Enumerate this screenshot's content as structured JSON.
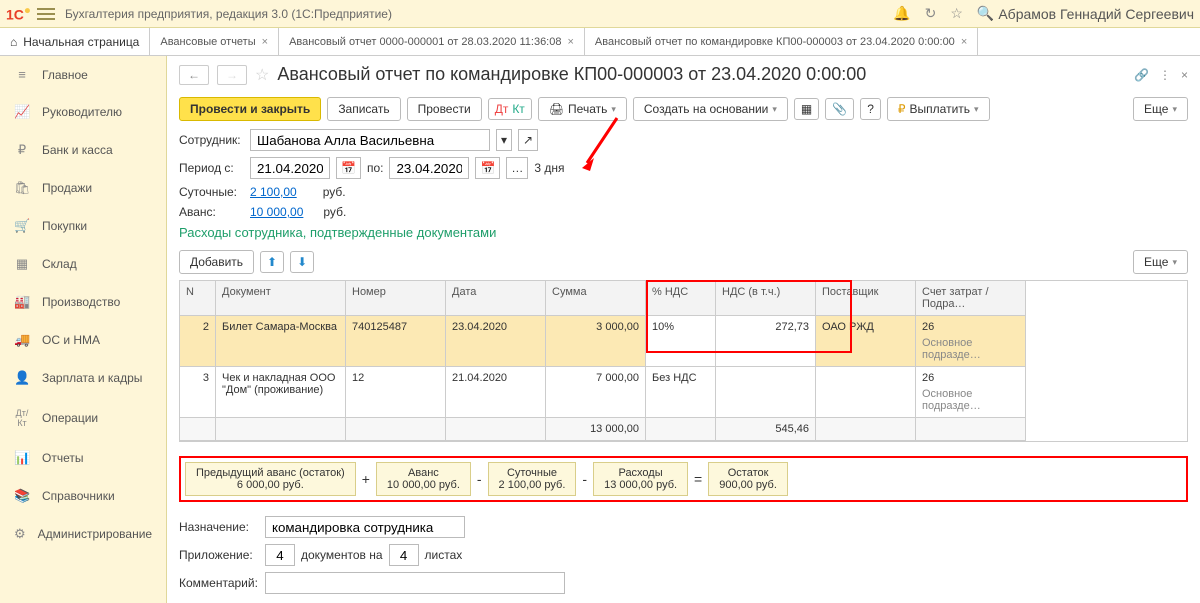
{
  "app": {
    "title": "Бухгалтерия предприятия, редакция 3.0  (1С:Предприятие)",
    "user": "Абрамов Геннадий Сергеевич"
  },
  "tabs": {
    "home": "Начальная страница",
    "t1": "Авансовые отчеты",
    "t2": "Авансовый отчет 0000-000001 от 28.03.2020 11:36:08",
    "t3": "Авансовый отчет по командировке КП00-000003 от 23.04.2020 0:00:00"
  },
  "sidebar": {
    "items": [
      {
        "icon": "≡",
        "label": "Главное"
      },
      {
        "icon": "📈",
        "label": "Руководителю"
      },
      {
        "icon": "₽",
        "label": "Банк и касса"
      },
      {
        "icon": "🛍",
        "label": "Продажи"
      },
      {
        "icon": "🛒",
        "label": "Покупки"
      },
      {
        "icon": "▦",
        "label": "Склад"
      },
      {
        "icon": "🏭",
        "label": "Производство"
      },
      {
        "icon": "🚚",
        "label": "ОС и НМА"
      },
      {
        "icon": "👤",
        "label": "Зарплата и кадры"
      },
      {
        "icon": "Дт/Кт",
        "label": "Операции"
      },
      {
        "icon": "📊",
        "label": "Отчеты"
      },
      {
        "icon": "📚",
        "label": "Справочники"
      },
      {
        "icon": "⚙",
        "label": "Администрирование"
      }
    ]
  },
  "page": {
    "title": "Авансовый отчет по командировке КП00-000003 от 23.04.2020 0:00:00"
  },
  "toolbar": {
    "process_close": "Провести и закрыть",
    "save": "Записать",
    "process": "Провести",
    "print": "Печать",
    "create_base": "Создать на основании",
    "pay": "Выплатить",
    "more": "Еще"
  },
  "form": {
    "employee_lbl": "Сотрудник:",
    "employee": "Шабанова Алла Васильевна",
    "period_lbl": "Период с:",
    "date_from": "21.04.2020",
    "to_lbl": "по:",
    "date_to": "23.04.2020",
    "days": "3 дня",
    "daily_lbl": "Суточные:",
    "daily": "2 100,00",
    "rub": "руб.",
    "advance_lbl": "Аванс:",
    "advance": "10 000,00",
    "section": "Расходы сотрудника, подтвержденные документами",
    "add": "Добавить"
  },
  "table": {
    "headers": [
      "N",
      "Документ",
      "Номер",
      "Дата",
      "Сумма",
      "% НДС",
      "НДС (в т.ч.)",
      "Поставщик",
      "Счет затрат / Подра…"
    ],
    "rows": [
      {
        "n": "2",
        "doc": "Билет Самара-Москва",
        "num": "740125487",
        "date": "23.04.2020",
        "sum": "3 000,00",
        "vat_pct": "10%",
        "vat": "272,73",
        "supplier": "ОАО РЖД",
        "acc": "26",
        "acc2": "Основное подразде…"
      },
      {
        "n": "3",
        "doc": "Чек и накладная ООО \"Дом\" (проживание)",
        "num": "12",
        "date": "21.04.2020",
        "sum": "7 000,00",
        "vat_pct": "Без НДС",
        "vat": "",
        "supplier": "",
        "acc": "26",
        "acc2": "Основное подразде…"
      }
    ],
    "totals": {
      "sum": "13 000,00",
      "vat": "545,46"
    }
  },
  "summary": {
    "b1_t": "Предыдущий аванс (остаток)",
    "b1_v": "6 000,00 руб.",
    "b2_t": "Аванс",
    "b2_v": "10 000,00 руб.",
    "b3_t": "Суточные",
    "b3_v": "2 100,00 руб.",
    "b4_t": "Расходы",
    "b4_v": "13 000,00 руб.",
    "b5_t": "Остаток",
    "b5_v": "900,00 руб."
  },
  "tail": {
    "purpose_lbl": "Назначение:",
    "purpose": "командировка сотрудника",
    "attach_lbl": "Приложение:",
    "docs": "4",
    "docs_lbl": "документов на",
    "sheets": "4",
    "sheets_lbl": "листах",
    "comment_lbl": "Комментарий:"
  }
}
